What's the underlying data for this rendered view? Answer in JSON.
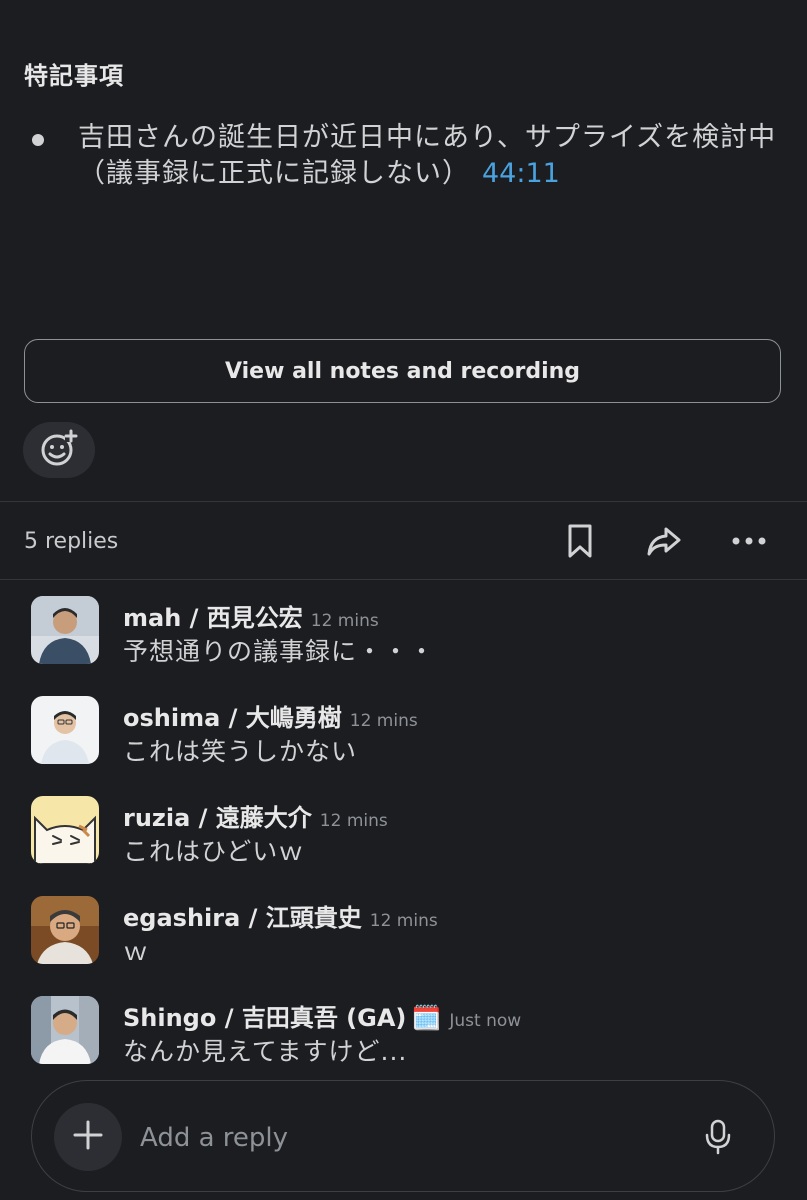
{
  "notes": {
    "section_title": "特記事項",
    "bullet_text": "吉田さんの誕生日が近日中にあり、サプライズを検討中（議事録に正式に記録しない）",
    "bullet_timestamp": "44:11"
  },
  "view_all_button": "View all notes and recording",
  "reaction_button_icon": "add-emoji-icon",
  "thread": {
    "replies_count": "5 replies",
    "actions": [
      "bookmark-icon",
      "share-icon",
      "more-icon"
    ]
  },
  "messages": [
    {
      "name": "mah / 西見公宏",
      "time": "12 mins",
      "text": "予想通りの議事録に・・・",
      "avatar_color": "#5a6f86"
    },
    {
      "name": "oshima / 大嶋勇樹",
      "time": "12 mins",
      "text": "これは笑うしかない",
      "avatar_color": "#e9ecef"
    },
    {
      "name": "ruzia / 遠藤大介",
      "time": "12 mins",
      "text": "これはひどいｗ",
      "avatar_color": "#f4e3a6"
    },
    {
      "name": "egashira / 江頭貴史",
      "time": "12 mins",
      "text": "ｗ",
      "avatar_color": "#8a5a2e"
    },
    {
      "name": "Shingo / 吉田真吾 (GA)",
      "time": "Just now",
      "text": "なんか見えてますけど...",
      "avatar_color": "#c9cdd2",
      "status_emoji": "🗓️"
    }
  ],
  "composer": {
    "placeholder": "Add a reply"
  },
  "colors": {
    "background": "#1b1d21",
    "link": "#4aa3df",
    "muted": "#8e9196"
  }
}
